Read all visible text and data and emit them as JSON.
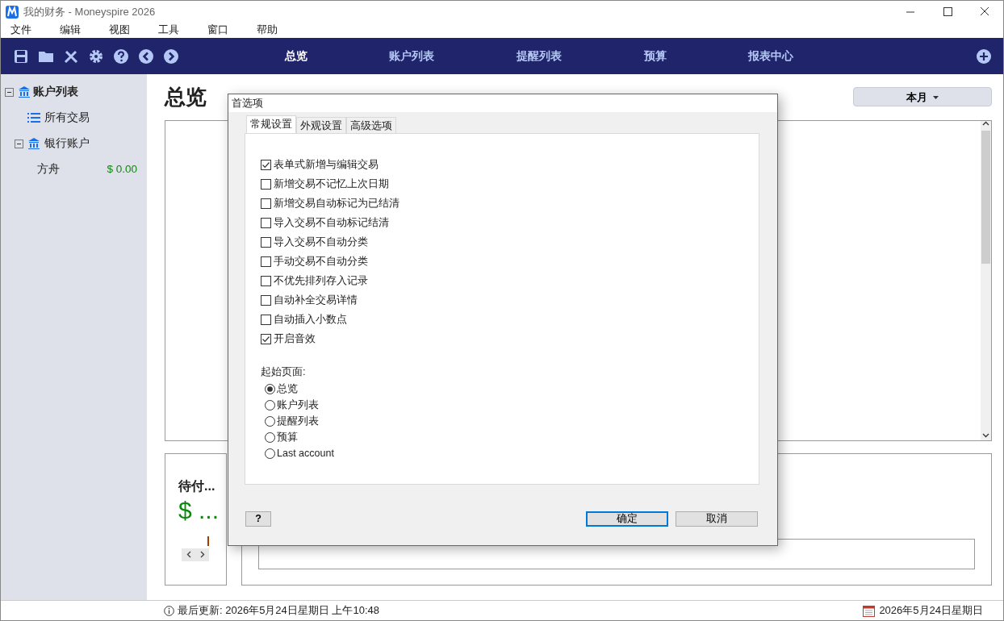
{
  "window": {
    "title": "我的财务 - Moneyspire 2026"
  },
  "menu": [
    "文件",
    "编辑",
    "视图",
    "工具",
    "窗口",
    "帮助"
  ],
  "nav": [
    {
      "label": "总览",
      "selected": true
    },
    {
      "label": "账户列表",
      "selected": false
    },
    {
      "label": "提醒列表",
      "selected": false
    },
    {
      "label": "预算",
      "selected": false
    },
    {
      "label": "报表中心",
      "selected": false
    }
  ],
  "sidebar": {
    "items": [
      {
        "label": "账户列表",
        "kind": "group",
        "expanded": true,
        "children": [
          {
            "label": "所有交易",
            "kind": "list"
          },
          {
            "label": "银行账户",
            "kind": "bank",
            "expanded": true,
            "children": [
              {
                "label": "方舟",
                "kind": "account",
                "amount": "$ 0.00"
              }
            ]
          }
        ]
      }
    ]
  },
  "page": {
    "title": "总览",
    "period": "本月"
  },
  "pending_card": {
    "title": "待付...",
    "amount": "$ ..."
  },
  "dialog": {
    "title": "首选项",
    "tabs": [
      {
        "label": "常规设置",
        "selected": true
      },
      {
        "label": "外观设置",
        "selected": false
      },
      {
        "label": "高级选项",
        "selected": false
      }
    ],
    "checkboxes": [
      {
        "label": "表单式新增与编辑交易",
        "checked": true
      },
      {
        "label": "新增交易不记忆上次日期",
        "checked": false
      },
      {
        "label": "新增交易自动标记为已结清",
        "checked": false
      },
      {
        "label": "导入交易不自动标记结清",
        "checked": false
      },
      {
        "label": "导入交易不自动分类",
        "checked": false
      },
      {
        "label": "手动交易不自动分类",
        "checked": false
      },
      {
        "label": "不优先排列存入记录",
        "checked": false
      },
      {
        "label": "自动补全交易详情",
        "checked": false
      },
      {
        "label": "自动插入小数点",
        "checked": false
      },
      {
        "label": "开启音效",
        "checked": true
      }
    ],
    "start_page": {
      "label": "起始页面:",
      "options": [
        {
          "label": "总览",
          "selected": true
        },
        {
          "label": "账户列表",
          "selected": false
        },
        {
          "label": "提醒列表",
          "selected": false
        },
        {
          "label": "预算",
          "selected": false
        },
        {
          "label": "Last account",
          "selected": false
        }
      ]
    },
    "help_button": "?",
    "buttons": [
      {
        "label": "确定",
        "focused": true
      },
      {
        "label": "取消",
        "focused": false
      }
    ]
  },
  "status_bar": {
    "last_updated": "最后更新: 2026年5月24日星期日 上午10:48",
    "date": "2026年5月24日星期日"
  }
}
